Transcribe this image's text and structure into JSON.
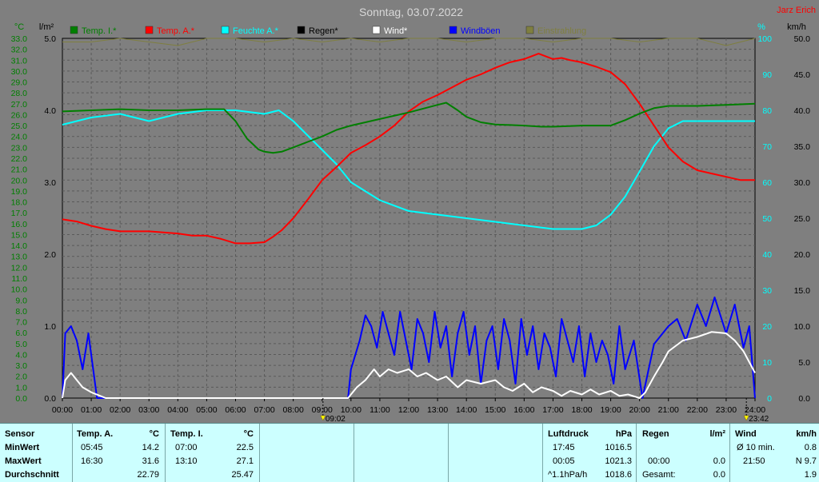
{
  "title": "Sonntag, 03.07.2022",
  "author": "Jarz Erich",
  "colors": {
    "background": "#7f7f7f",
    "temp_inside": "#007f00",
    "temp_outside": "#ff0000",
    "humidity": "#00ffff",
    "rain": "#000000",
    "wind": "#ffffff",
    "gust": "#0000ff",
    "sunshine": "#7f7f3f"
  },
  "legend": [
    {
      "label": "Temp. I.*",
      "color": "#007f00"
    },
    {
      "label": "Temp. A.*",
      "color": "#ff0000"
    },
    {
      "label": "Feuchte A.*",
      "color": "#00ffff"
    },
    {
      "label": "Regen*",
      "color": "#000000"
    },
    {
      "label": "Wind*",
      "color": "#ffffff"
    },
    {
      "label": "Windböen",
      "color": "#0000ff"
    },
    {
      "label": "Einstrahlung",
      "color": "#7f7f3f"
    }
  ],
  "axis_units": {
    "temp": "°C",
    "rain": "l/m²",
    "humidity": "%",
    "wind": "km/h"
  },
  "markers": [
    {
      "label": "09:02",
      "x": 9.03,
      "icon": "sunrise-icon"
    },
    {
      "label": "23:42",
      "x": 23.7,
      "icon": "sunset-icon"
    }
  ],
  "chart_data": {
    "type": "line",
    "title": "Sonntag, 03.07.2022",
    "xlabel": "",
    "x_ticks": [
      "00:00",
      "01:00",
      "02:00",
      "03:00",
      "04:00",
      "05:00",
      "06:00",
      "07:00",
      "08:00",
      "09:00",
      "10:00",
      "11:00",
      "12:00",
      "13:00",
      "14:00",
      "15:00",
      "16:00",
      "17:00",
      "18:00",
      "19:00",
      "20:00",
      "21:00",
      "22:00",
      "23:00",
      "24:00"
    ],
    "xlim": [
      0,
      24
    ],
    "axes": {
      "temp": {
        "label": "°C",
        "ylim": [
          0,
          33
        ],
        "ticks": [
          "0.0",
          "1.0",
          "2.0",
          "3.0",
          "4.0",
          "5.0",
          "6.0",
          "7.0",
          "8.0",
          "9.0",
          "10.0",
          "11.0",
          "12.0",
          "13.0",
          "14.0",
          "15.0",
          "16.0",
          "17.0",
          "18.0",
          "19.0",
          "20.0",
          "21.0",
          "22.0",
          "23.0",
          "24.0",
          "25.0",
          "26.0",
          "27.0",
          "28.0",
          "29.0",
          "30.0",
          "31.0",
          "32.0",
          "33.0"
        ]
      },
      "rain": {
        "label": "l/m²",
        "ylim": [
          0,
          5
        ],
        "ticks": [
          "0.0",
          "1.0",
          "2.0",
          "3.0",
          "4.0",
          "5.0"
        ]
      },
      "humidity": {
        "label": "%",
        "ylim": [
          0,
          100
        ],
        "ticks": [
          "0",
          "10",
          "20",
          "30",
          "40",
          "50",
          "60",
          "70",
          "80",
          "90",
          "100"
        ]
      },
      "wind": {
        "label": "km/h",
        "ylim": [
          0,
          50
        ],
        "ticks": [
          "0.0",
          "5.0",
          "10.0",
          "15.0",
          "20.0",
          "25.0",
          "30.0",
          "35.0",
          "40.0",
          "45.0",
          "50.0"
        ]
      }
    },
    "series": [
      {
        "name": "Temp. I.*",
        "axis": "temp",
        "color": "#007f00",
        "x": [
          0,
          1,
          2,
          3,
          4,
          5,
          5.6,
          6,
          6.4,
          6.8,
          7,
          7.3,
          7.6,
          8,
          8.5,
          9,
          9.5,
          10,
          11,
          12,
          13,
          13.3,
          13.7,
          14,
          14.5,
          15,
          16,
          16.6,
          17,
          18,
          19,
          19.5,
          20,
          20.5,
          21,
          22,
          23,
          24
        ],
        "y": [
          26.3,
          26.4,
          26.5,
          26.4,
          26.4,
          26.5,
          26.5,
          25.4,
          23.8,
          22.8,
          22.6,
          22.5,
          22.6,
          23.0,
          23.5,
          24.0,
          24.6,
          25.0,
          25.6,
          26.2,
          26.9,
          27.1,
          26.4,
          25.8,
          25.3,
          25.1,
          25.0,
          24.9,
          24.9,
          25.0,
          25.0,
          25.5,
          26.1,
          26.6,
          26.8,
          26.8,
          26.9,
          27.0
        ]
      },
      {
        "name": "Temp. A.*",
        "axis": "temp",
        "color": "#ff0000",
        "x": [
          0,
          0.5,
          1,
          1.5,
          2,
          3,
          4,
          4.5,
          5,
          5.5,
          6,
          6.5,
          7,
          7.3,
          7.6,
          8,
          8.5,
          9,
          9.5,
          10,
          10.5,
          11,
          11.5,
          12,
          12.5,
          13,
          13.5,
          14,
          14.5,
          15,
          15.5,
          16,
          16.5,
          17,
          17.3,
          17.6,
          18,
          18.5,
          19,
          19.5,
          20,
          20.5,
          21,
          21.5,
          22,
          22.5,
          23,
          23.5,
          24
        ],
        "y": [
          16.4,
          16.2,
          15.8,
          15.5,
          15.3,
          15.3,
          15.1,
          14.9,
          14.9,
          14.6,
          14.2,
          14.2,
          14.3,
          14.8,
          15.4,
          16.5,
          18.2,
          20.0,
          21.2,
          22.5,
          23.2,
          24.0,
          25.0,
          26.3,
          27.2,
          27.8,
          28.5,
          29.2,
          29.7,
          30.3,
          30.8,
          31.1,
          31.6,
          31.1,
          31.2,
          31.0,
          30.8,
          30.4,
          29.9,
          28.8,
          27.0,
          25.0,
          23.0,
          21.7,
          20.9,
          20.6,
          20.3,
          20.0,
          20.0
        ]
      },
      {
        "name": "Feuchte A.*",
        "axis": "humidity",
        "color": "#00ffff",
        "x": [
          0,
          1,
          2,
          3,
          4,
          5,
          6,
          7,
          7.5,
          8,
          8.5,
          9,
          9.5,
          10,
          11,
          12,
          13,
          14,
          15,
          16,
          17,
          17.5,
          18,
          18.5,
          19,
          19.5,
          20,
          20.5,
          21,
          21.5,
          22,
          23,
          24
        ],
        "y": [
          76,
          78,
          79,
          77,
          79,
          80,
          80,
          79,
          80,
          77,
          73,
          69,
          65,
          60,
          55,
          52,
          51,
          50,
          49,
          48,
          47,
          47,
          47,
          48,
          51,
          56,
          63,
          70,
          75,
          77,
          77,
          77,
          77
        ]
      },
      {
        "name": "Einstrahlung",
        "axis": "humidity",
        "color": "#7f7f3f",
        "x": [
          0,
          1,
          2,
          3,
          4,
          5,
          6,
          7,
          8,
          9,
          10,
          11,
          12,
          13,
          14,
          15,
          16,
          17,
          18,
          19,
          20,
          21,
          22,
          23,
          24
        ],
        "y": [
          99,
          99,
          100,
          99,
          98,
          100,
          100,
          99,
          100,
          99,
          100,
          99,
          100,
          100,
          99,
          100,
          100,
          99,
          100,
          100,
          99,
          100,
          100,
          98,
          100
        ]
      },
      {
        "name": "Wind*",
        "axis": "wind",
        "color": "#ffffff",
        "x": [
          0,
          0.1,
          0.3,
          0.5,
          0.7,
          1,
          1.5,
          2,
          9.9,
          10,
          10.2,
          10.5,
          10.8,
          11,
          11.3,
          11.6,
          12,
          12.3,
          12.6,
          13,
          13.3,
          13.7,
          14,
          14.5,
          15,
          15.3,
          15.6,
          16,
          16.3,
          16.6,
          17,
          17.3,
          17.6,
          18,
          18.3,
          18.6,
          19,
          19.3,
          19.6,
          20,
          20.2,
          20.5,
          20.8,
          21,
          21.5,
          22,
          22.5,
          23,
          23.3,
          23.6,
          24
        ],
        "y": [
          0,
          2.5,
          3.5,
          2.5,
          1.5,
          0.8,
          0,
          0,
          0,
          0.5,
          1.5,
          2.5,
          4,
          3,
          4,
          3.5,
          4,
          3,
          3.5,
          2.5,
          3,
          1.5,
          2.5,
          2,
          2.5,
          1.5,
          1,
          2,
          0.8,
          1.5,
          1,
          0.3,
          1,
          0.5,
          1.2,
          0.5,
          1,
          0.3,
          0.5,
          0,
          0.8,
          3,
          5,
          6.5,
          8,
          8.5,
          9.2,
          9,
          8,
          6.5,
          3.5
        ]
      },
      {
        "name": "Windböen",
        "axis": "wind",
        "color": "#0000ff",
        "x": [
          0,
          0.1,
          0.3,
          0.5,
          0.7,
          0.9,
          1.2,
          1.3,
          9.9,
          10,
          10.3,
          10.5,
          10.7,
          10.9,
          11.1,
          11.3,
          11.5,
          11.7,
          11.9,
          12.1,
          12.3,
          12.5,
          12.7,
          12.9,
          13.1,
          13.3,
          13.5,
          13.7,
          13.9,
          14.1,
          14.3,
          14.5,
          14.7,
          14.9,
          15.1,
          15.3,
          15.5,
          15.7,
          15.9,
          16.1,
          16.3,
          16.5,
          16.7,
          16.9,
          17.1,
          17.3,
          17.5,
          17.7,
          17.9,
          18.1,
          18.3,
          18.5,
          18.7,
          18.9,
          19.1,
          19.3,
          19.5,
          19.8,
          20.1,
          20.5,
          21,
          21.3,
          21.6,
          22,
          22.3,
          22.6,
          23,
          23.3,
          23.6,
          23.8,
          24
        ],
        "y": [
          0,
          9,
          10,
          8,
          4,
          9,
          0,
          0,
          0,
          4,
          8,
          11.5,
          10,
          7,
          12,
          9,
          6,
          12,
          8,
          4,
          11,
          9,
          5,
          12,
          7,
          10,
          3,
          9,
          12,
          6,
          10,
          2,
          8,
          10,
          4,
          11,
          8,
          2,
          11,
          6,
          10,
          4,
          9,
          7,
          3,
          11,
          8,
          5,
          10,
          3,
          9,
          5,
          8,
          6,
          2,
          10,
          4,
          8,
          0,
          7.5,
          10,
          11,
          8,
          13,
          10,
          14,
          9,
          13,
          7,
          10,
          0
        ]
      }
    ],
    "rain_series": {
      "name": "Regen*",
      "axis": "rain",
      "x": [
        0,
        24
      ],
      "y": [
        0,
        0
      ]
    }
  },
  "stats": {
    "sensor": {
      "header": "Sensor",
      "rows": [
        "MinWert",
        "MaxWert",
        "Durchschnitt"
      ]
    },
    "temp_a": {
      "header": "Temp. A.",
      "unit": "°C",
      "rows": [
        [
          "05:45",
          "14.2"
        ],
        [
          "16:30",
          "31.6"
        ],
        [
          "",
          "22.79"
        ]
      ]
    },
    "temp_i": {
      "header": "Temp. I.",
      "unit": "°C",
      "rows": [
        [
          "07:00",
          "22.5"
        ],
        [
          "13:10",
          "27.1"
        ],
        [
          "",
          "25.47"
        ]
      ]
    },
    "pressure": {
      "header": "Luftdruck",
      "unit": "hPa",
      "rows": [
        [
          "17:45",
          "1016.5"
        ],
        [
          "00:05",
          "1021.3"
        ],
        [
          "^1.1hPa/h",
          "1018.6"
        ]
      ]
    },
    "rain": {
      "header": "Regen",
      "unit": "l/m²",
      "rows": [
        [
          "",
          ""
        ],
        [
          "00:00",
          "0.0"
        ],
        [
          "Gesamt:",
          "0.0"
        ]
      ]
    },
    "wind": {
      "header": "Wind",
      "unit": "km/h",
      "rows": [
        [
          "Ø 10 min.",
          "0.8"
        ],
        [
          "21:50",
          "N 9.7"
        ],
        [
          "",
          "1.9"
        ]
      ]
    }
  }
}
